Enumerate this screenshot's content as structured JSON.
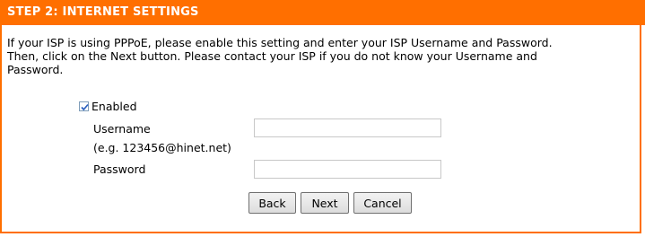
{
  "header": {
    "title": "STEP 2: INTERNET SETTINGS"
  },
  "intro": {
    "line1": "If your ISP is using PPPoE, please enable this setting and enter your ISP Username and Password.",
    "line2": "Then, click on the Next button. Please contact your ISP if you do not know your Username and",
    "line3": "Password."
  },
  "form": {
    "enabled_label": "Enabled",
    "enabled_checked": true,
    "username_label": "Username",
    "username_hint": "(e.g. 123456@hinet.net)",
    "username_value": "",
    "password_label": "Password",
    "password_value": ""
  },
  "buttons": {
    "back": "Back",
    "next": "Next",
    "cancel": "Cancel"
  },
  "colors": {
    "accent": "#ff6f00",
    "header_text": "#ffffff"
  }
}
